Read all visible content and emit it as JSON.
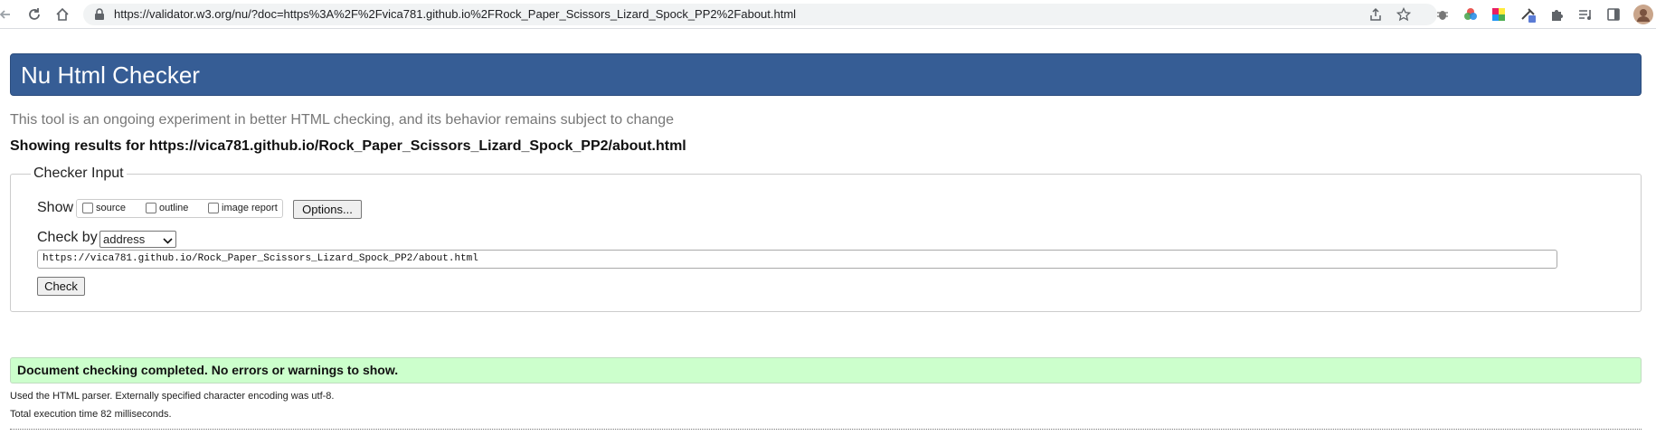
{
  "browser": {
    "url": "https://validator.w3.org/nu/?doc=https%3A%2F%2Fvica781.github.io%2FRock_Paper_Scissors_Lizard_Spock_PP2%2Fabout.html",
    "icons": [
      "back-icon",
      "reload-icon",
      "home-icon",
      "lock-icon",
      "share-icon",
      "star-icon",
      "bug-extension-icon",
      "color-wheel-extension-icon",
      "palette-extension-icon",
      "eyedropper-extension-icon",
      "puzzle-extensions-icon",
      "reading-list-icon",
      "side-panel-icon",
      "profile-avatar"
    ],
    "colors": {
      "toolbar_bg": "#ffffff",
      "omnibox_bg": "#f1f3f4"
    }
  },
  "page": {
    "title": "Nu Html Checker",
    "experiment_note": "This tool is an ongoing experiment in better HTML checking, and its behavior remains subject to change",
    "showing_results": "Showing results for https://vica781.github.io/Rock_Paper_Scissors_Lizard_Spock_PP2/about.html",
    "colors": {
      "header_bg": "#365d95",
      "success_bg": "#ccffcc"
    }
  },
  "checker": {
    "legend": "Checker Input",
    "show_label": "Show",
    "options": [
      {
        "label": "source",
        "checked": false
      },
      {
        "label": "outline",
        "checked": false
      },
      {
        "label": "image report",
        "checked": false
      }
    ],
    "options_button": "Options...",
    "check_by_label": "Check by",
    "check_by_value": "address",
    "url_value": "https://vica781.github.io/Rock_Paper_Scissors_Lizard_Spock_PP2/about.html",
    "check_button": "Check"
  },
  "results": {
    "success_message": "Document checking completed. No errors or warnings to show.",
    "parser_note": "Used the HTML parser. Externally specified character encoding was utf-8.",
    "execution_time": "Total execution time 82 milliseconds."
  }
}
